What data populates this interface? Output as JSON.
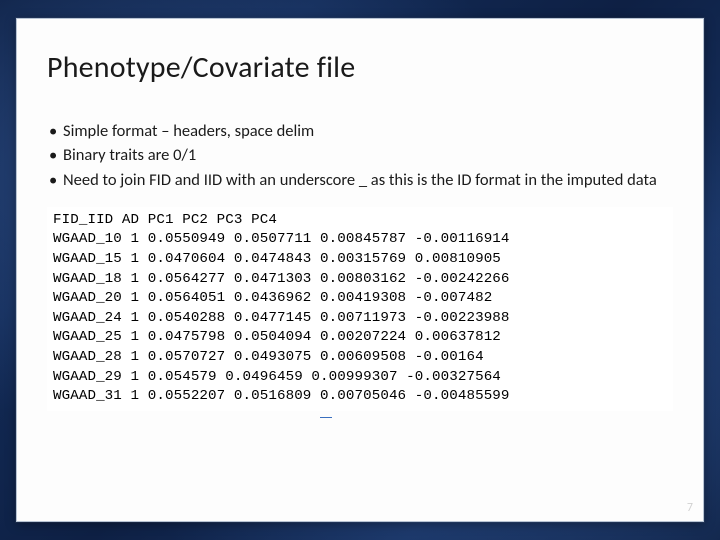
{
  "slide": {
    "title": "Phenotype/Covariate file",
    "bullets": [
      "Simple format – headers, space delim",
      "Binary traits are 0/1",
      "Need to join FID and IID with an underscore _ as this is the ID format in the imputed data"
    ],
    "page_number": "7"
  },
  "file_preview": {
    "header": "FID_IID AD PC1 PC2 PC3 PC4",
    "rows": [
      "WGAAD_10 1 0.0550949 0.0507711 0.00845787 -0.00116914",
      "WGAAD_15 1 0.0470604 0.0474843 0.00315769 0.00810905",
      "WGAAD_18 1 0.0564277 0.0471303 0.00803162 -0.00242266",
      "WGAAD_20 1 0.0564051 0.0436962 0.00419308 -0.007482",
      "WGAAD_24 1 0.0540288 0.0477145 0.00711973 -0.00223988",
      "WGAAD_25 1 0.0475798 0.0504094 0.00207224 0.00637812",
      "WGAAD_28 1 0.0570727 0.0493075 0.00609508 -0.00164",
      "WGAAD_29 1 0.054579 0.0496459 0.00999307 -0.00327564",
      "WGAAD_31 1 0.0552207 0.0516809 0.00705046 -0.00485599"
    ]
  }
}
